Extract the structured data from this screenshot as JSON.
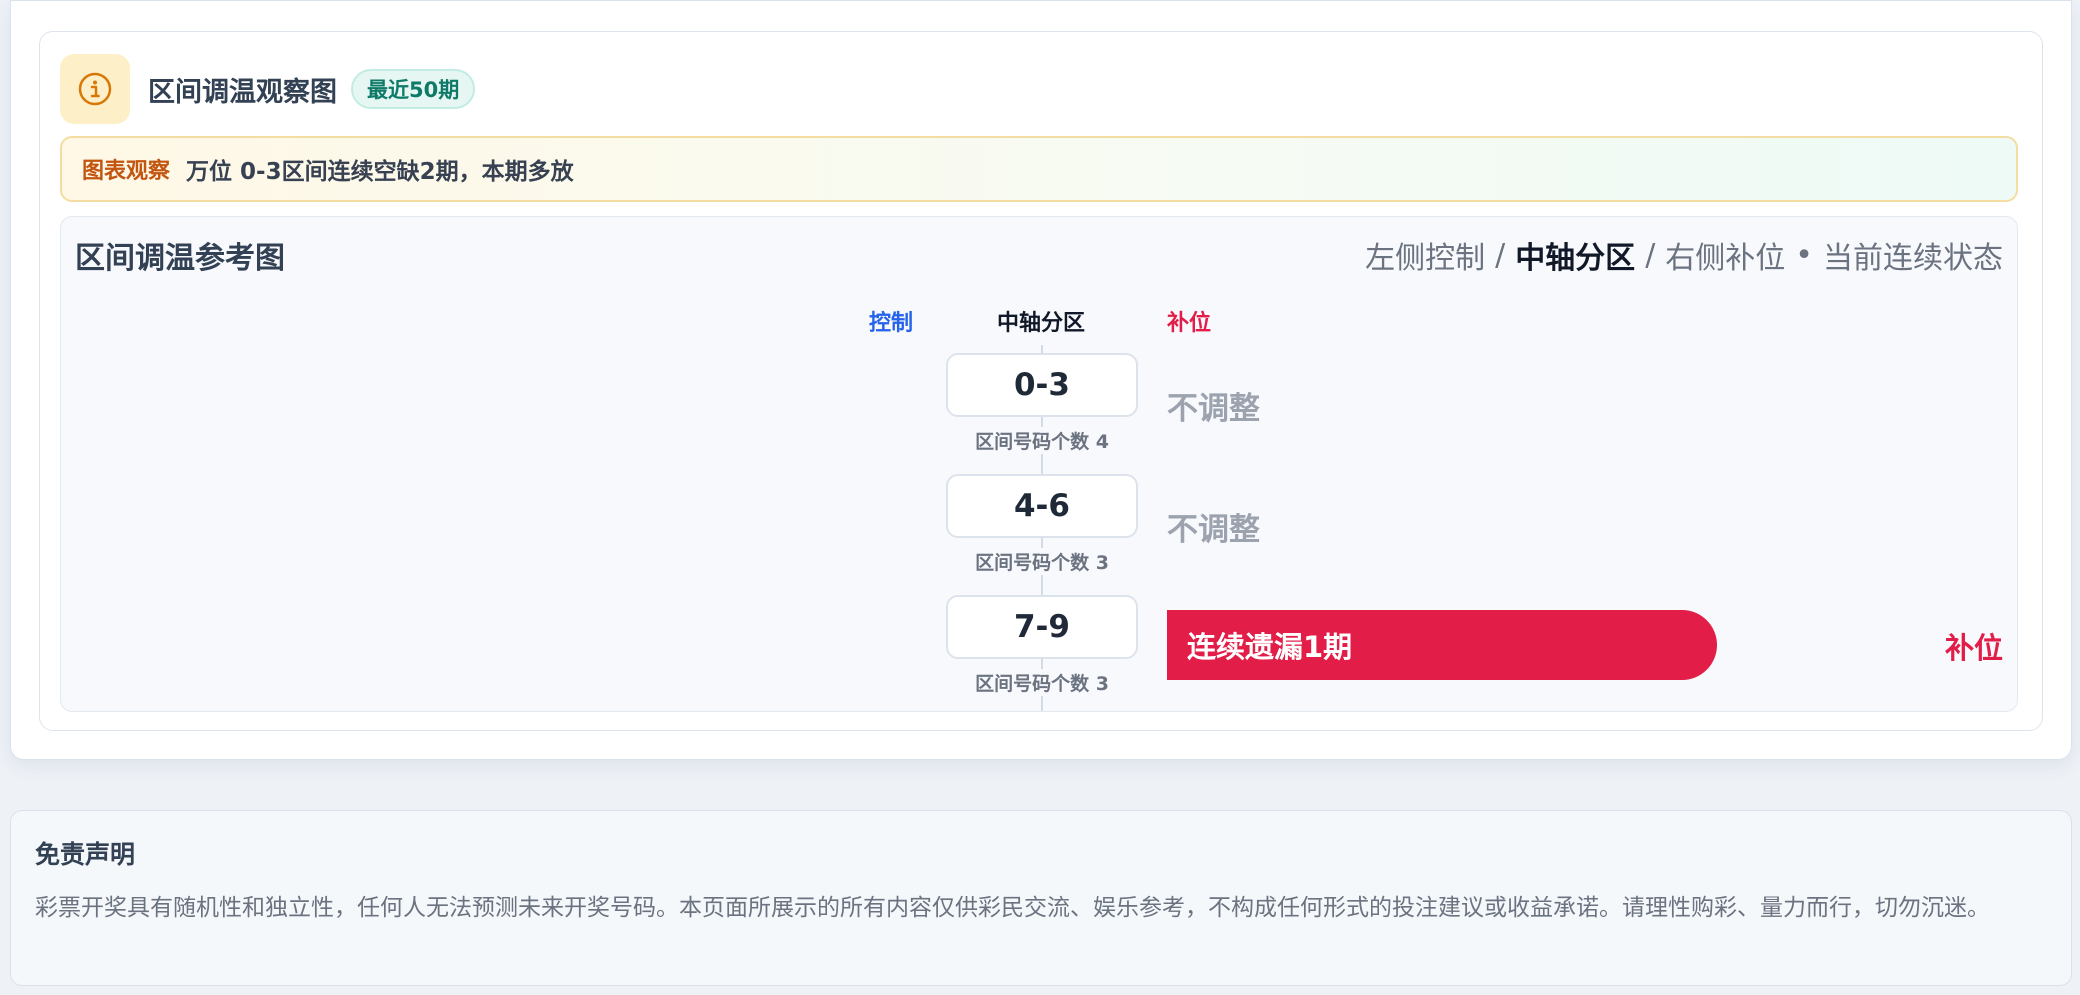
{
  "panel": {
    "title": "区间调温观察图",
    "badge": "最近50期"
  },
  "observation": {
    "label": "图表观察",
    "text": "万位 0-3区间连续空缺2期，本期多放"
  },
  "reference": {
    "title": "区间调温参考图",
    "legend": {
      "left": "左侧控制",
      "sep1": "/",
      "center": "中轴分区",
      "sep2": "/",
      "right": "右侧补位",
      "dot": "•",
      "state": "当前连续状态"
    },
    "columns": {
      "control": "控制",
      "axis": "中轴分区",
      "fill": "补位"
    },
    "zones": [
      {
        "range": "0-3",
        "count_text": "区间号码个数 4",
        "status": "不调整"
      },
      {
        "range": "4-6",
        "count_text": "区间号码个数 3",
        "status": "不调整"
      },
      {
        "range": "7-9",
        "count_text": "区间号码个数 3",
        "status": "连续遗漏1期",
        "side": "补位"
      }
    ]
  },
  "disclaimer": {
    "title": "免责声明",
    "text": "彩票开奖具有随机性和独立性，任何人无法预测未来开奖号码。本页面所展示的所有内容仅供彩民交流、娱乐参考，不构成任何形式的投注建议或收益承诺。请理性购彩、量力而行，切勿沉迷。"
  },
  "colors": {
    "control": "#2563eb",
    "fill": "#e11d48",
    "badge": "#0f7a68",
    "observe_label": "#c2550f"
  },
  "icons": {
    "header": "info-icon"
  }
}
